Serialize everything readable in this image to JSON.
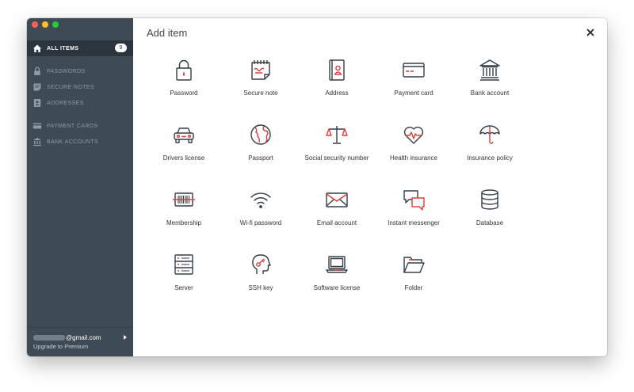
{
  "window": {
    "traffic_lights": [
      "close",
      "minimize",
      "zoom"
    ]
  },
  "sidebar": {
    "items": [
      {
        "label": "ALL ITEMS",
        "icon": "home-icon",
        "badge": "9",
        "active": true
      },
      {
        "label": "PASSWORDS",
        "icon": "lock-icon"
      },
      {
        "label": "SECURE NOTES",
        "icon": "note-icon"
      },
      {
        "label": "ADDRESSES",
        "icon": "address-card-icon"
      },
      {
        "label": "PAYMENT CARDS",
        "icon": "credit-card-icon"
      },
      {
        "label": "BANK ACCOUNTS",
        "icon": "bank-icon"
      }
    ],
    "account": {
      "email_suffix": "@gmail.com",
      "upgrade_label": "Upgrade to Premium"
    }
  },
  "dialog": {
    "title": "Add item",
    "close_icon": "close-icon",
    "items": [
      {
        "label": "Password",
        "icon": "padlock-icon"
      },
      {
        "label": "Secure note",
        "icon": "secure-note-icon"
      },
      {
        "label": "Address",
        "icon": "address-book-icon"
      },
      {
        "label": "Payment card",
        "icon": "payment-card-icon"
      },
      {
        "label": "Bank account",
        "icon": "bank-building-icon"
      },
      {
        "label": "Drivers license",
        "icon": "car-icon"
      },
      {
        "label": "Passport",
        "icon": "globe-icon"
      },
      {
        "label": "Social security number",
        "icon": "scales-icon"
      },
      {
        "label": "Health insurance",
        "icon": "heart-pulse-icon"
      },
      {
        "label": "Insurance policy",
        "icon": "umbrella-icon"
      },
      {
        "label": "Membership",
        "icon": "barcode-card-icon"
      },
      {
        "label": "Wi-fi password",
        "icon": "wifi-icon"
      },
      {
        "label": "Email account",
        "icon": "envelope-icon"
      },
      {
        "label": "Instant messenger",
        "icon": "chat-bubbles-icon"
      },
      {
        "label": "Database",
        "icon": "database-icon"
      },
      {
        "label": "Server",
        "icon": "server-icon"
      },
      {
        "label": "SSH key",
        "icon": "head-key-icon"
      },
      {
        "label": "Software license",
        "icon": "laptop-icon"
      },
      {
        "label": "Folder",
        "icon": "folder-icon"
      }
    ]
  },
  "colors": {
    "sidebar_bg": "#3e4a54",
    "sidebar_active_bg": "#2b353d",
    "icon_stroke": "#333e48",
    "icon_accent": "#d9403a"
  }
}
